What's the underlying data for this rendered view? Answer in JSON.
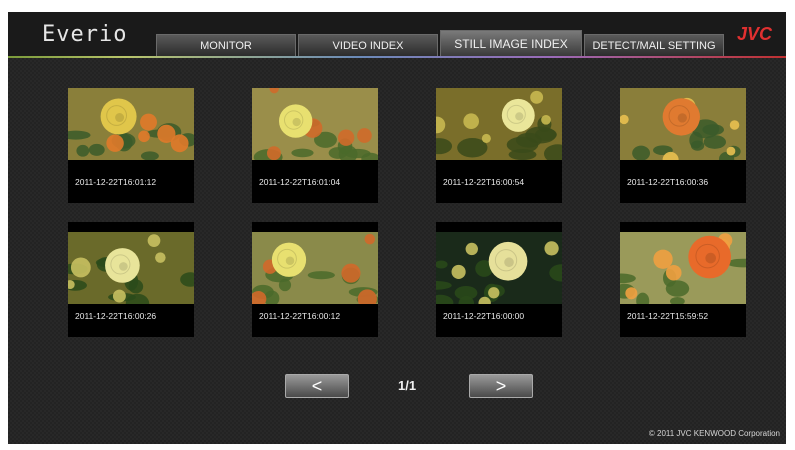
{
  "header": {
    "brand": "Everio",
    "logo": "JVC",
    "tabs": [
      {
        "label": "MONITOR",
        "active": false
      },
      {
        "label": "VIDEO INDEX",
        "active": false
      },
      {
        "label": "STILL IMAGE INDEX",
        "active": true
      },
      {
        "label": "DETECT/MAIL SETTING",
        "active": false
      }
    ]
  },
  "images": [
    {
      "timestamp": "2011-12-22T16:01:12",
      "palette": [
        "#8a7f3a",
        "#e0c64a",
        "#e07a2a",
        "#3a5a2a"
      ]
    },
    {
      "timestamp": "2011-12-22T16:01:04",
      "palette": [
        "#9a8e4a",
        "#e8e070",
        "#d06a2a",
        "#4a6a2a"
      ]
    },
    {
      "timestamp": "2011-12-22T16:00:54",
      "palette": [
        "#7a6e2a",
        "#eae69a",
        "#c8b850",
        "#3a4a1a"
      ]
    },
    {
      "timestamp": "2011-12-22T16:00:36",
      "palette": [
        "#8a7e3a",
        "#e07a30",
        "#e8c050",
        "#3a5a2a"
      ]
    },
    {
      "timestamp": "2011-12-22T16:00:26",
      "palette": [
        "#6a6a2a",
        "#e8e49a",
        "#c8c060",
        "#2a4a1a"
      ]
    },
    {
      "timestamp": "2011-12-22T16:00:12",
      "palette": [
        "#8a8a4a",
        "#e8e070",
        "#d0682a",
        "#4a6a2a"
      ]
    },
    {
      "timestamp": "2011-12-22T16:00:00",
      "palette": [
        "#1a2a1a",
        "#e6e09a",
        "#c8c060",
        "#2a4a1a"
      ]
    },
    {
      "timestamp": "2011-12-22T15:59:52",
      "palette": [
        "#9a9a5a",
        "#e86a2a",
        "#f0a040",
        "#4a6a2a"
      ]
    }
  ],
  "pager": {
    "prev_symbol": "<",
    "next_symbol": ">",
    "page": "1/1"
  },
  "footer": {
    "copyright": "© 2011 JVC KENWOOD Corporation"
  }
}
